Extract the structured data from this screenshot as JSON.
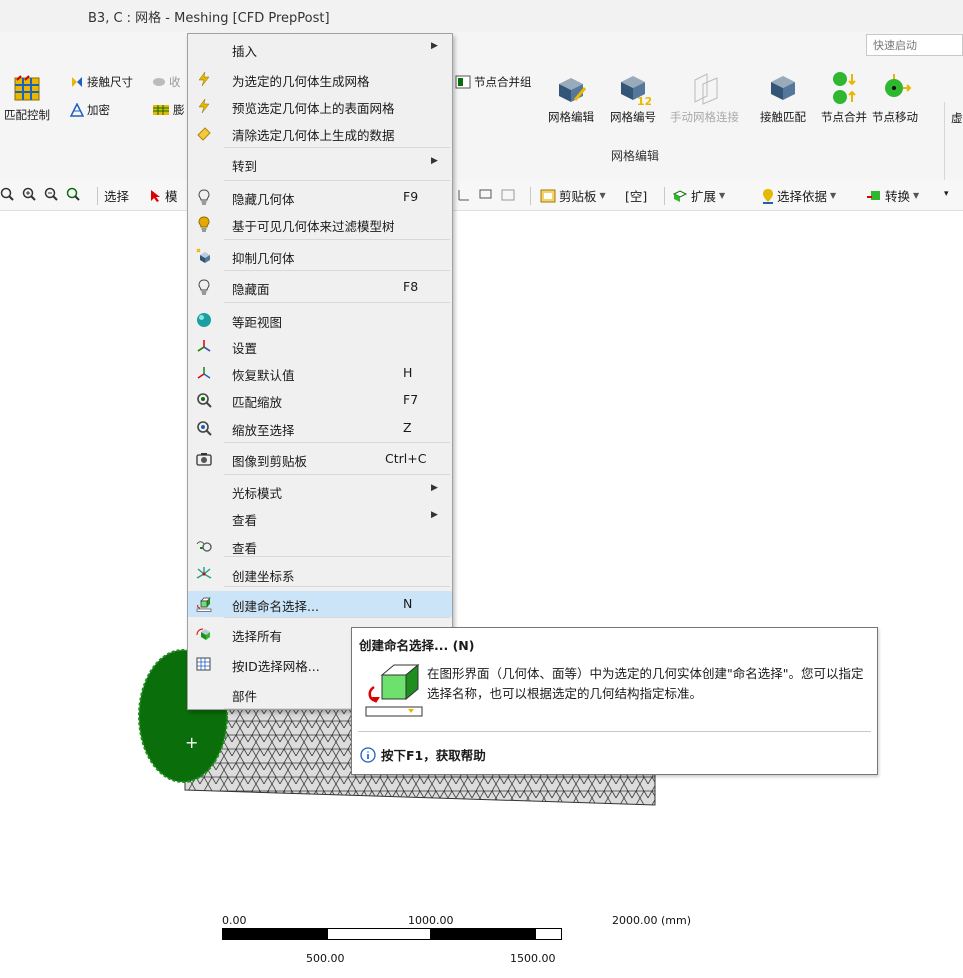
{
  "window": {
    "title": "B3, C : 网格 - Meshing [CFD PrepPost]",
    "quick_launch": "快速启动"
  },
  "ribbon": {
    "match_control": "匹配控制",
    "contact_sizing": "接触尺寸",
    "contact_sizing_icon": "contact-icon",
    "shrink_label": "收",
    "refine": "加密",
    "inflate_label": "膨",
    "node_merge_group": "节点合并组",
    "mesh_edit": "网格编辑",
    "mesh_numbering": "网格编号",
    "mesh_numbering_badge": "12",
    "manual_mesh_connection": "手动网格连接",
    "contact_match": "接触匹配",
    "node_merge": "节点合并",
    "node_move": "节点移动",
    "partial_next": "虚",
    "group_label": "网格编辑"
  },
  "toolbar": {
    "select": "选择",
    "mode_partial": "模",
    "clipboard": "剪贴板",
    "empty": "[空]",
    "extend": "扩展",
    "select_by": "选择依据",
    "convert": "转换"
  },
  "menu": {
    "items": [
      {
        "label": "插入",
        "shortcut": "",
        "submenu": true,
        "icon": "none"
      },
      {
        "label": "为选定的几何体生成网格",
        "shortcut": "",
        "submenu": false,
        "icon": "lightning-icon"
      },
      {
        "label": "预览选定几何体上的表面网格",
        "shortcut": "",
        "submenu": false,
        "icon": "lightning-icon"
      },
      {
        "label": "清除选定几何体上生成的数据",
        "shortcut": "",
        "submenu": false,
        "icon": "eraser-icon"
      },
      {
        "label": "转到",
        "shortcut": "",
        "submenu": true,
        "icon": "none"
      },
      {
        "label": "隐藏几何体",
        "shortcut": "F9",
        "submenu": false,
        "icon": "bulb-off-icon"
      },
      {
        "label": "基于可见几何体来过滤模型树",
        "shortcut": "",
        "submenu": false,
        "icon": "bulb-on-icon"
      },
      {
        "label": "抑制几何体",
        "shortcut": "",
        "submenu": false,
        "icon": "suppress-icon"
      },
      {
        "label": "隐藏面",
        "shortcut": "F8",
        "submenu": false,
        "icon": "bulb-off-icon"
      },
      {
        "label": "等距视图",
        "shortcut": "",
        "submenu": false,
        "icon": "sphere-icon"
      },
      {
        "label": "设置",
        "shortcut": "",
        "submenu": false,
        "icon": "axes-icon"
      },
      {
        "label": "恢复默认值",
        "shortcut": "H",
        "submenu": false,
        "icon": "axes-reset-icon"
      },
      {
        "label": "匹配缩放",
        "shortcut": "F7",
        "submenu": false,
        "icon": "zoom-fit-icon"
      },
      {
        "label": "缩放至选择",
        "shortcut": "Z",
        "submenu": false,
        "icon": "zoom-select-icon"
      },
      {
        "label": "图像到剪贴板",
        "shortcut": "Ctrl+C",
        "submenu": false,
        "icon": "camera-icon"
      },
      {
        "label": "光标模式",
        "shortcut": "",
        "submenu": true,
        "icon": "none"
      },
      {
        "label": "查看",
        "shortcut": "",
        "submenu": true,
        "icon": "none"
      },
      {
        "label": "查看",
        "shortcut": "",
        "submenu": false,
        "icon": "view-icon"
      },
      {
        "label": "创建坐标系",
        "shortcut": "",
        "submenu": false,
        "icon": "coordinate-system-icon"
      },
      {
        "label": "创建命名选择...",
        "shortcut": "N",
        "submenu": false,
        "icon": "named-selection-icon"
      },
      {
        "label": "选择所有",
        "shortcut": "",
        "submenu": false,
        "icon": "select-all-icon"
      },
      {
        "label": "按ID选择网格...",
        "shortcut": "",
        "submenu": false,
        "icon": "select-by-id-icon"
      },
      {
        "label": "部件",
        "shortcut": "",
        "submenu": false,
        "icon": "none"
      }
    ]
  },
  "tooltip": {
    "title": "创建命名选择... (N)",
    "body": "在图形界面（几何体、面等）中为选定的几何实体创建\"命名选择\"。您可以指定选择名称，也可以根据选定的几何结构指定标准。",
    "help": "按下F1，获取帮助"
  },
  "scale": {
    "top_labels": [
      "0.00",
      "1000.00",
      "2000.00 (mm)"
    ],
    "bottom_labels": [
      "500.00",
      "1500.00"
    ]
  },
  "viewport": {
    "cursor": "+"
  },
  "colors": {
    "highlight": "#cce4f7",
    "mesh_face": "#0a6e0a",
    "ribbon_bg": "#f5f5f5"
  }
}
